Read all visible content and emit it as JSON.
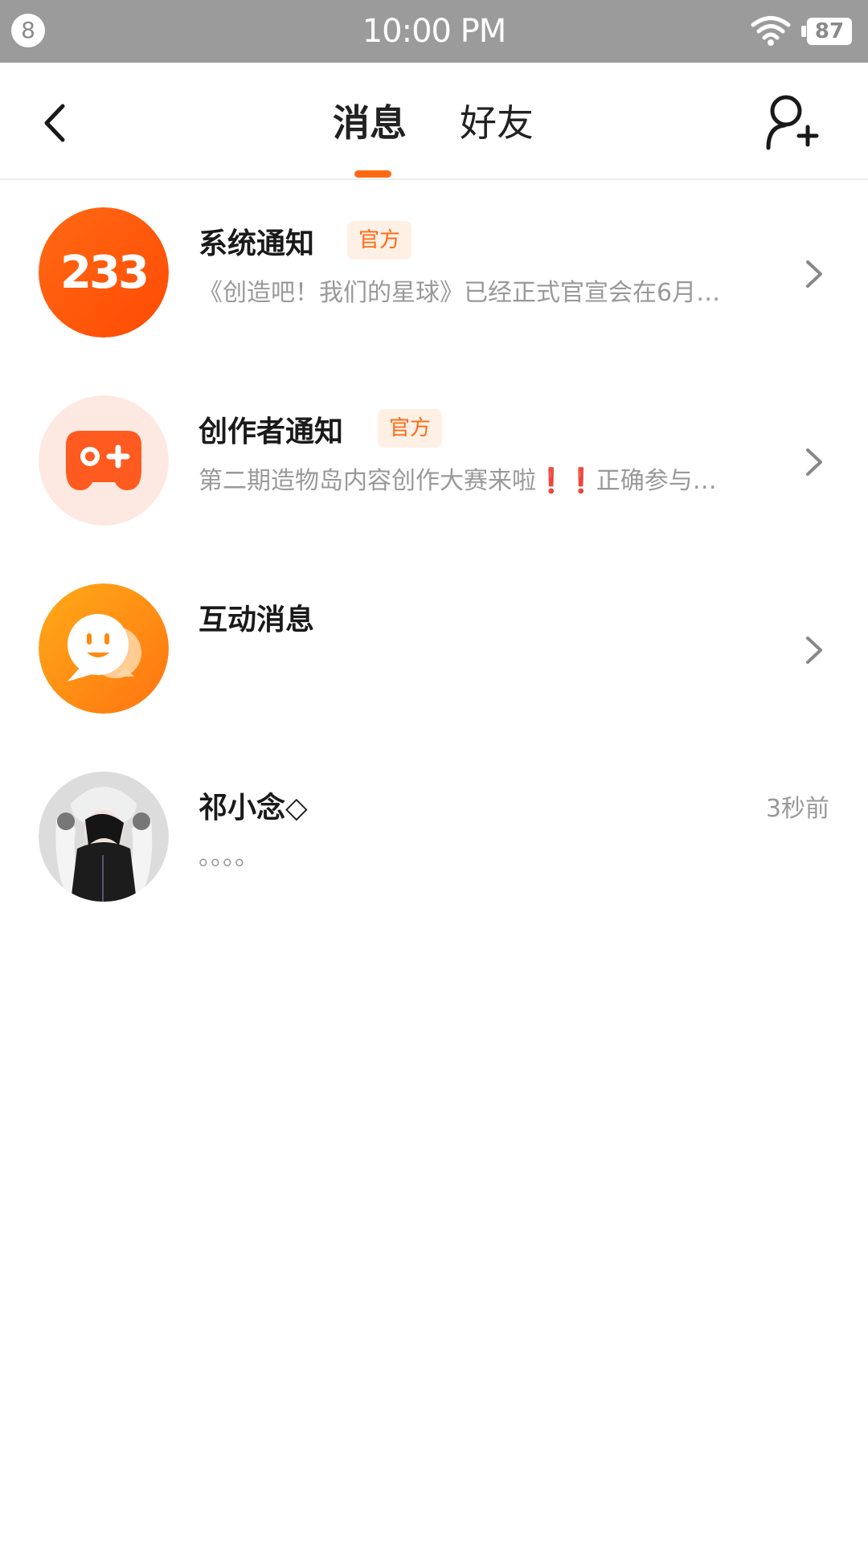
{
  "status_bar": {
    "notification_count": "8",
    "time": "10:00 PM",
    "battery": "87",
    "icons": [
      "wifi-icon",
      "battery-icon"
    ]
  },
  "header": {
    "back_icon": "chevron-left-icon",
    "tabs": [
      {
        "label": "消息",
        "active": true
      },
      {
        "label": "好友",
        "active": false
      }
    ],
    "add_friend_icon": "add-user-icon"
  },
  "colors": {
    "accent": "#ff6a13",
    "badge_bg": "#fff0e6",
    "status_bar": "#9b9b9b"
  },
  "messages": [
    {
      "title": "系统通知",
      "badge": "官方",
      "preview": "《创造吧！我们的星球》已经正式官宣会在6月…",
      "icon": "233-logo-icon"
    },
    {
      "title": "创作者通知",
      "badge": "官方",
      "preview": "第二期造物岛内容创作大赛来啦❗❗正确参与…",
      "icon": "gamepad-icon"
    },
    {
      "title": "互动消息",
      "preview": "",
      "icon": "chat-bubble-icon"
    },
    {
      "title": "祁小念◇",
      "preview": "。。。。",
      "time": "3秒前",
      "icon": "user-avatar"
    }
  ]
}
